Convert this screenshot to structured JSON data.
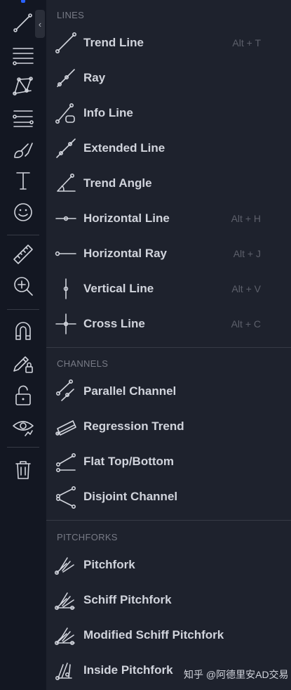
{
  "sections": [
    {
      "title": "LINES",
      "items": [
        {
          "label": "Trend Line",
          "hotkey": "Alt + T",
          "icon": "trend-line-icon"
        },
        {
          "label": "Ray",
          "hotkey": "",
          "icon": "ray-icon"
        },
        {
          "label": "Info Line",
          "hotkey": "",
          "icon": "info-line-icon"
        },
        {
          "label": "Extended Line",
          "hotkey": "",
          "icon": "extended-line-icon"
        },
        {
          "label": "Trend Angle",
          "hotkey": "",
          "icon": "trend-angle-icon"
        },
        {
          "label": "Horizontal Line",
          "hotkey": "Alt + H",
          "icon": "horizontal-line-icon"
        },
        {
          "label": "Horizontal Ray",
          "hotkey": "Alt + J",
          "icon": "horizontal-ray-icon"
        },
        {
          "label": "Vertical Line",
          "hotkey": "Alt + V",
          "icon": "vertical-line-icon"
        },
        {
          "label": "Cross Line",
          "hotkey": "Alt + C",
          "icon": "cross-line-icon"
        }
      ]
    },
    {
      "title": "CHANNELS",
      "items": [
        {
          "label": "Parallel Channel",
          "hotkey": "",
          "icon": "parallel-channel-icon"
        },
        {
          "label": "Regression Trend",
          "hotkey": "",
          "icon": "regression-trend-icon"
        },
        {
          "label": "Flat Top/Bottom",
          "hotkey": "",
          "icon": "flat-top-bottom-icon"
        },
        {
          "label": "Disjoint Channel",
          "hotkey": "",
          "icon": "disjoint-channel-icon"
        }
      ]
    },
    {
      "title": "PITCHFORKS",
      "items": [
        {
          "label": "Pitchfork",
          "hotkey": "",
          "icon": "pitchfork-icon"
        },
        {
          "label": "Schiff Pitchfork",
          "hotkey": "",
          "icon": "schiff-pitchfork-icon"
        },
        {
          "label": "Modified Schiff Pitchfork",
          "hotkey": "",
          "icon": "modified-schiff-pitchfork-icon"
        },
        {
          "label": "Inside Pitchfork",
          "hotkey": "",
          "icon": "inside-pitchfork-icon"
        }
      ]
    }
  ],
  "toolbar": {
    "collapse_glyph": "‹",
    "tools": [
      "trend-line-icon",
      "fib-retracement-icon",
      "patterns-icon",
      "prediction-icon",
      "brush-icon",
      "text-icon",
      "emoji-icon",
      "ruler-icon",
      "zoom-in-icon",
      "magnet-icon",
      "lock-drawing-icon",
      "unlock-icon",
      "eye-icon",
      "trash-icon"
    ]
  },
  "watermark": "知乎 @阿德里安AD交易",
  "colors": {
    "accent": "#2962ff",
    "text": "#d1d4dc",
    "muted": "#787b86",
    "panel": "#1e222d",
    "toolbar": "#131722"
  }
}
